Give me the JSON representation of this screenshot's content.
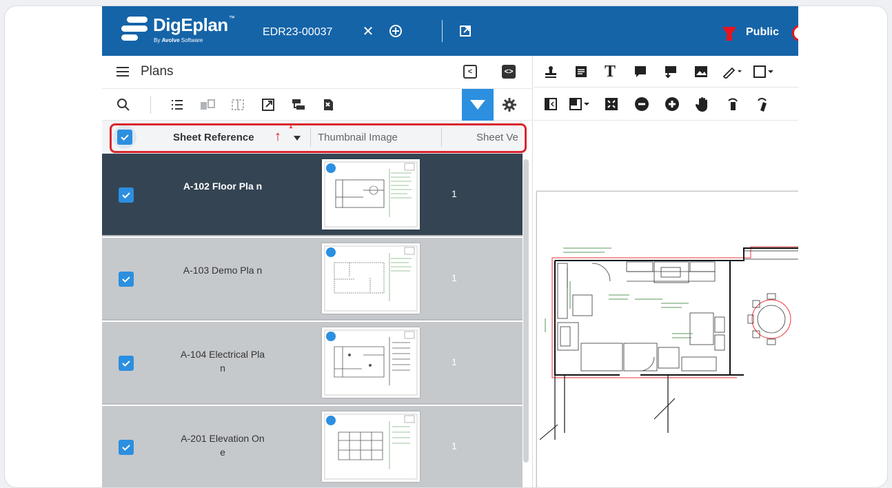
{
  "header": {
    "logo_title": "DigEplan",
    "logo_tm": "™",
    "logo_by": "By",
    "logo_company": "Avolve",
    "logo_software": "Software",
    "doc_id": "EDR23-00037",
    "public_label": "Public",
    "icons": [
      "close-icon",
      "add-circle-icon",
      "open-external-icon"
    ]
  },
  "plans_panel": {
    "title": "Plans",
    "columns": {
      "sheet_reference": "Sheet Reference",
      "sort_order": "1",
      "thumbnail": "Thumbnail Image",
      "sheet_version": "Sheet Ve"
    },
    "rows": [
      {
        "name": "A-102 Floor Pla n",
        "version": "1",
        "selected": true
      },
      {
        "name": "A-103 Demo Pla n",
        "version": "1",
        "selected": false
      },
      {
        "name": "A-104 Electrical Plan",
        "version": "1",
        "selected": false
      },
      {
        "name": "A-201 Elevation One",
        "version": "1",
        "selected": false
      }
    ]
  },
  "colors": {
    "header_bg": "#1564a8",
    "accent": "#2c8fe0",
    "selected_row": "#344453",
    "highlight": "#d9272e",
    "public_filter": "#e8131c"
  }
}
